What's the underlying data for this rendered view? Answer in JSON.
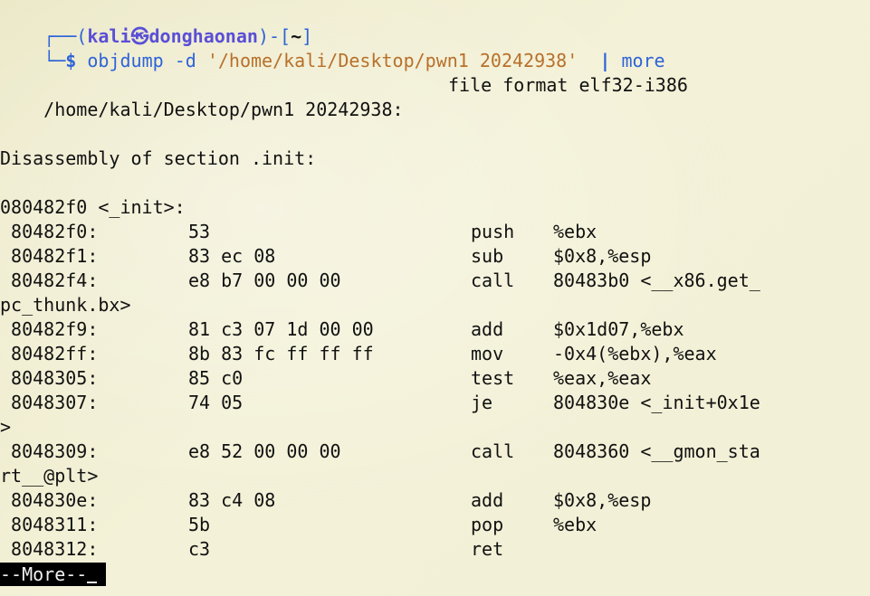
{
  "prompt": {
    "box_open": "┌──(",
    "user": "kali",
    "skull": "㉿",
    "host": "donghaonan",
    "box_mid": ")-[",
    "dir": "~",
    "box_close": "]",
    "corner": "└─",
    "dollar": "$",
    "command": "objdump",
    "flag": "-d",
    "path": "'/home/kali/Desktop/pwn1 20242938'",
    "pipe": "|",
    "pager": "more"
  },
  "file_header": {
    "path": "/home/kali/Desktop/pwn1 20242938:",
    "format": "file format elf32-i386"
  },
  "section_header": "Disassembly of section .init:",
  "function_header": "080482f0 <_init>:",
  "instructions": [
    {
      "addr": " 80482f0:",
      "bytes": "53",
      "mnemonic": "push",
      "operands": "%ebx"
    },
    {
      "addr": " 80482f1:",
      "bytes": "83 ec 08",
      "mnemonic": "sub",
      "operands": "$0x8,%esp"
    },
    {
      "addr": " 80482f4:",
      "bytes": "e8 b7 00 00 00",
      "mnemonic": "call",
      "operands": "80483b0 <__x86.get_",
      "wrap": "pc_thunk.bx>"
    },
    {
      "addr": " 80482f9:",
      "bytes": "81 c3 07 1d 00 00",
      "mnemonic": "add",
      "operands": "$0x1d07,%ebx"
    },
    {
      "addr": " 80482ff:",
      "bytes": "8b 83 fc ff ff ff",
      "mnemonic": "mov",
      "operands": "-0x4(%ebx),%eax"
    },
    {
      "addr": " 8048305:",
      "bytes": "85 c0",
      "mnemonic": "test",
      "operands": "%eax,%eax"
    },
    {
      "addr": " 8048307:",
      "bytes": "74 05",
      "mnemonic": "je",
      "operands": "804830e <_init+0x1e",
      "wrap": ">"
    },
    {
      "addr": " 8048309:",
      "bytes": "e8 52 00 00 00",
      "mnemonic": "call",
      "operands": "8048360 <__gmon_sta",
      "wrap": "rt__@plt>"
    },
    {
      "addr": " 804830e:",
      "bytes": "83 c4 08",
      "mnemonic": "add",
      "operands": "$0x8,%esp"
    },
    {
      "addr": " 8048311:",
      "bytes": "5b",
      "mnemonic": "pop",
      "operands": "%ebx"
    },
    {
      "addr": " 8048312:",
      "bytes": "c3",
      "mnemonic": "ret",
      "operands": ""
    }
  ],
  "pager_status": "--More--",
  "colors": {
    "prompt_blue": "#2e64d8",
    "prompt_purple": "#5a4fd6",
    "path_orange": "#b8702a",
    "text": "#111111",
    "background": "#efedcf"
  }
}
